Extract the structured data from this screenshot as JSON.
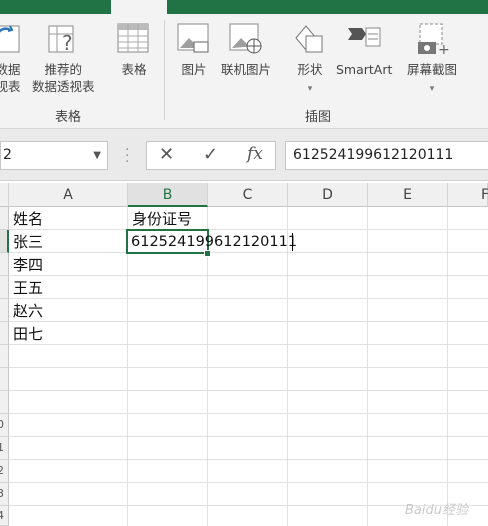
{
  "ribbon": {
    "tables_group": {
      "label": "表格",
      "items": [
        {
          "label_line1": "数据",
          "label_line2": "视表"
        },
        {
          "label_line1": "推荐的",
          "label_line2": "数据透视表"
        },
        {
          "label": "表格"
        }
      ]
    },
    "illustrations_group": {
      "label": "插图",
      "items": [
        {
          "label": "图片"
        },
        {
          "label": "联机图片"
        },
        {
          "label": "形状"
        },
        {
          "label": "SmartArt"
        },
        {
          "label": "屏幕截图"
        }
      ]
    }
  },
  "formula_bar": {
    "name_box": "2",
    "cancel_glyph": "✕",
    "enter_glyph": "✓",
    "fx_glyph": "fx",
    "value": "612524199612120111"
  },
  "grid": {
    "columns": [
      "A",
      "B",
      "C",
      "D",
      "E",
      "F"
    ],
    "selected_column": "B",
    "rows": [
      {
        "A": "姓名",
        "B": "身份证号"
      },
      {
        "A": "张三",
        "B": "612524199612120111"
      },
      {
        "A": "李四"
      },
      {
        "A": "王五"
      },
      {
        "A": "赵六"
      },
      {
        "A": "田七"
      }
    ],
    "partial_row_numbers": [
      "0",
      "1",
      "2",
      "3",
      "4"
    ]
  },
  "watermark": "Baidu经验",
  "colors": {
    "accent": "#217346",
    "ribbon_bg": "#f3f3f3",
    "gridline": "#e1e1e1"
  }
}
